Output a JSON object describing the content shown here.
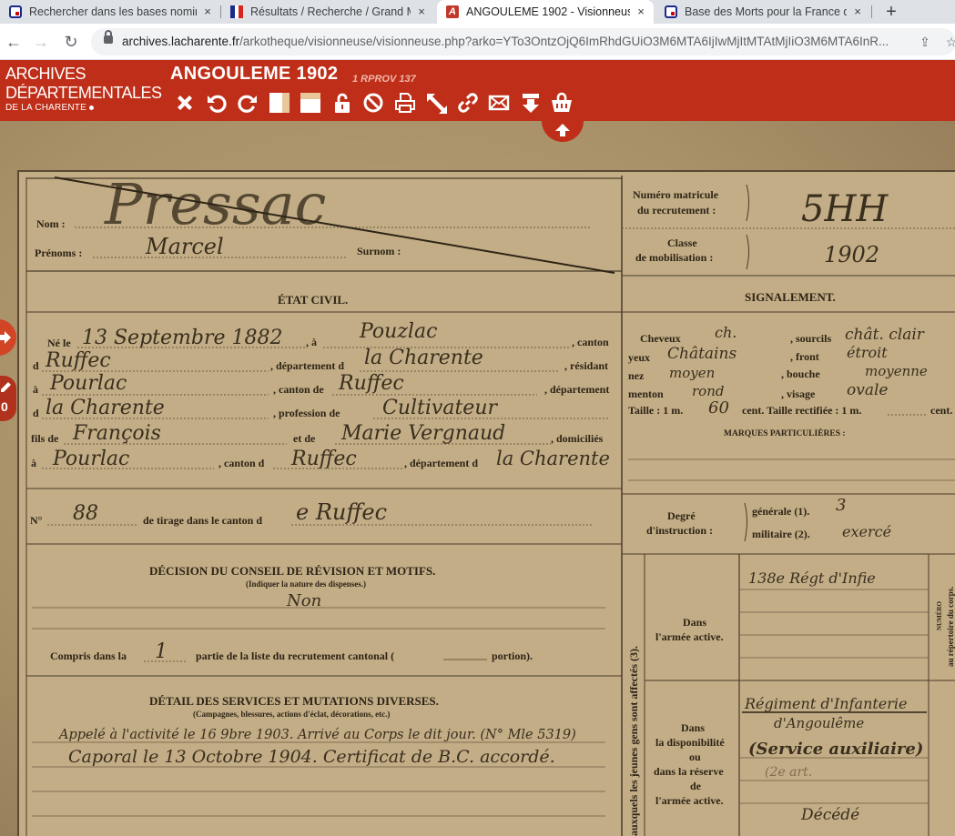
{
  "tabs": [
    {
      "title": "Rechercher dans les bases nomin",
      "favicon": "archives-favicon"
    },
    {
      "title": "Résultats / Recherche / Grand Mé",
      "favicon": "french-flag-favicon"
    },
    {
      "title": "ANGOULEME 1902 - Visionneuse",
      "favicon": "arkotheque-favicon",
      "favicon_letter": "A"
    },
    {
      "title": "Base des Morts pour la France de",
      "favicon": "archives-favicon"
    }
  ],
  "icons": {
    "tab_close": "×",
    "new_tab": "+",
    "back": "←",
    "forward": "→",
    "reload": "↻",
    "share": "⇪",
    "star": "☆"
  },
  "address": {
    "host": "archives.lacharente.fr",
    "path": "/arkotheque/visionneuse/visionneuse.php?arko=YTo3OntzOjQ6ImRhdGUiO3M6MTA6IjIwMjItMTAtMjIiO3M6MTA6InR..."
  },
  "site": {
    "logo_line1": "ARCHIVES",
    "logo_line2": "DÉPARTEMENTALES",
    "logo_line3": "DE LA CHARENTE",
    "title": "ANGOULEME 1902",
    "cote": "1 RPROV 137"
  },
  "toolbar_tools": [
    "close-icon",
    "rotate-left-icon",
    "rotate-right-icon",
    "vertical-split-icon",
    "horizontal-split-icon",
    "unlock-icon",
    "cancel-icon",
    "print-icon",
    "fullscreen-icon",
    "link-icon",
    "email-icon",
    "download-icon",
    "basket-lock-icon"
  ],
  "viewer": {
    "annotation_count": "0"
  },
  "document": {
    "nom_label": "Nom :",
    "nom_value": "Pressac",
    "prenoms_label": "Prénoms :",
    "prenoms_value": "Marcel",
    "surnom_label": "Surnom :",
    "matricule_label1": "Numéro matricule",
    "matricule_label2": "du recrutement :",
    "matricule_value": "5HH",
    "classe_label1": "Classe",
    "classe_label2": "de mobilisation :",
    "classe_value": "1902",
    "etat_civil": "ÉTAT CIVIL.",
    "signalement": "SIGNALEMENT.",
    "ne_le": "Né le",
    "ne_le_value": "13 Septembre 1882",
    "a_label": ", à",
    "ne_lieu": "Pouzlac",
    "canton_label": ", canton",
    "d_label": "d",
    "canton_value": "Ruffec",
    "departement_label": ", département d",
    "departement_value": "la Charente",
    "residant": ", résidant",
    "a2": "à",
    "residant_value": "Pourlac",
    "canton2_label": ", canton de",
    "canton2_value": "Ruffec",
    "departement2": ", département",
    "d2": "d",
    "departement2_value": "la Charente",
    "profession_label": ", profession de",
    "profession_value": "Cultivateur",
    "fils_label": "fils de",
    "pere": "François",
    "et_label": "et de",
    "mere": "Marie Vergnaud",
    "domicilies": ", domiciliés",
    "a3": "à",
    "domicile": "Pourlac",
    "canton3": ", canton d",
    "canton3_value": "Ruffec",
    "departement3": ", département d",
    "departement3_value": "la Charente",
    "no_label": "N°",
    "no_value": "88",
    "tirage_label": "de tirage dans le canton d",
    "tirage_value": "e Ruffec",
    "decision_title": "DÉCISION DU CONSEIL DE RÉVISION ET MOTIFS.",
    "decision_sub": "(Indiquer la nature des dispenses.)",
    "decision_value": "Non",
    "compris_label": "Compris dans la",
    "compris_value": "1",
    "compris_rest": "partie de la liste du recrutement cantonal (",
    "portion": "portion).",
    "detail_title": "DÉTAIL DES SERVICES ET MUTATIONS DIVERSES.",
    "detail_sub": "(Campagnes, blessures, actions d'éclat, décorations, etc.)",
    "detail_line1": "Appelé à l'activité le 16 9bre 1903. Arrivé au Corps le dit jour. (N° Mle 5319)",
    "detail_line2": "Caporal le 13 Octobre 1904. Certificat de B.C. accordé.",
    "cheveux_label": "Cheveux",
    "cheveux_value": "ch.",
    "sourcils_label": ", sourcils",
    "sourcils_value": "chât. clair",
    "yeux_label": "yeux",
    "yeux_value": "Châtains",
    "front_label": ", front",
    "front_value": "étroit",
    "nez_label": "nez",
    "nez_value": "moyen",
    "bouche_label": ", bouche",
    "bouche_value": "moyenne",
    "menton_label": "menton",
    "menton_value": "rond",
    "visage_label": ", visage",
    "visage_value": "ovale",
    "taille_label": "Taille : 1 m.",
    "taille_value": "60",
    "taille_rest": "cent. Taille rectifiée : 1 m.",
    "taille_end": "cent.",
    "marques": "MARQUES PARTICULIÈRES :",
    "degre1": "Degré",
    "degre2": "d'instruction :",
    "generale_label": "générale (1).",
    "generale_value": "3",
    "militaire_label": "militaire (2).",
    "militaire_value": "exercé",
    "armee_active_label1": "Dans",
    "armee_active_label2": "l'armée active.",
    "armee_active_value": "138e Régt d'Infie",
    "dispo1": "Dans",
    "dispo2": "la disponibilité",
    "dispo3": "ou",
    "dispo4": "dans la réserve",
    "dispo5": "de",
    "dispo6": "l'armée active.",
    "reserve_value1": "Régiment d'Infanterie",
    "reserve_value2": "d'Angoulême",
    "reserve_value3": "(Service auxiliaire)",
    "reserve_value4": "(2e art.",
    "decede": "Décédé",
    "vertical_label": "auxquels les jeunes gens sont affectés (3).",
    "numero_label": "NUMÉRO",
    "repertoire_label": "au répertoire du corps."
  }
}
